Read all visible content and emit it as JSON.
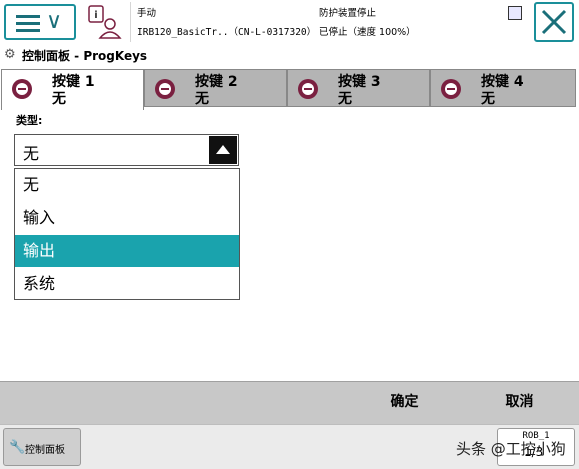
{
  "header": {
    "mode": "手动",
    "system": "IRB120_BasicTr..（CN-L-0317320）",
    "safety": "防护装置停止",
    "state": "已停止（速度 100%）"
  },
  "title": "控制面板 - ProgKeys",
  "tabs": [
    {
      "label": "按键 1",
      "value": "无"
    },
    {
      "label": "按键 2",
      "value": "无"
    },
    {
      "label": "按键 3",
      "value": "无"
    },
    {
      "label": "按键 4",
      "value": "无"
    }
  ],
  "type_label": "类型:",
  "type_select": {
    "value": "无",
    "options": [
      "无",
      "输入",
      "输出",
      "系统"
    ],
    "highlighted": "输出"
  },
  "commands": {
    "ok": "确定",
    "cancel": "取消"
  },
  "taskbar": {
    "item": "控制面板",
    "rob_label": "ROB_1",
    "rob_sub": "1/3"
  },
  "watermark": "头条 @工控小狗",
  "colors": {
    "accent": "#1aa3ad",
    "frame": "#1a8f9a",
    "tab_icon": "#7a2040"
  },
  "icons": [
    "menu-icon",
    "user-icon",
    "tool-icon",
    "close-icon",
    "control-panel-icon",
    "program-key-icon",
    "robot-icon"
  ]
}
